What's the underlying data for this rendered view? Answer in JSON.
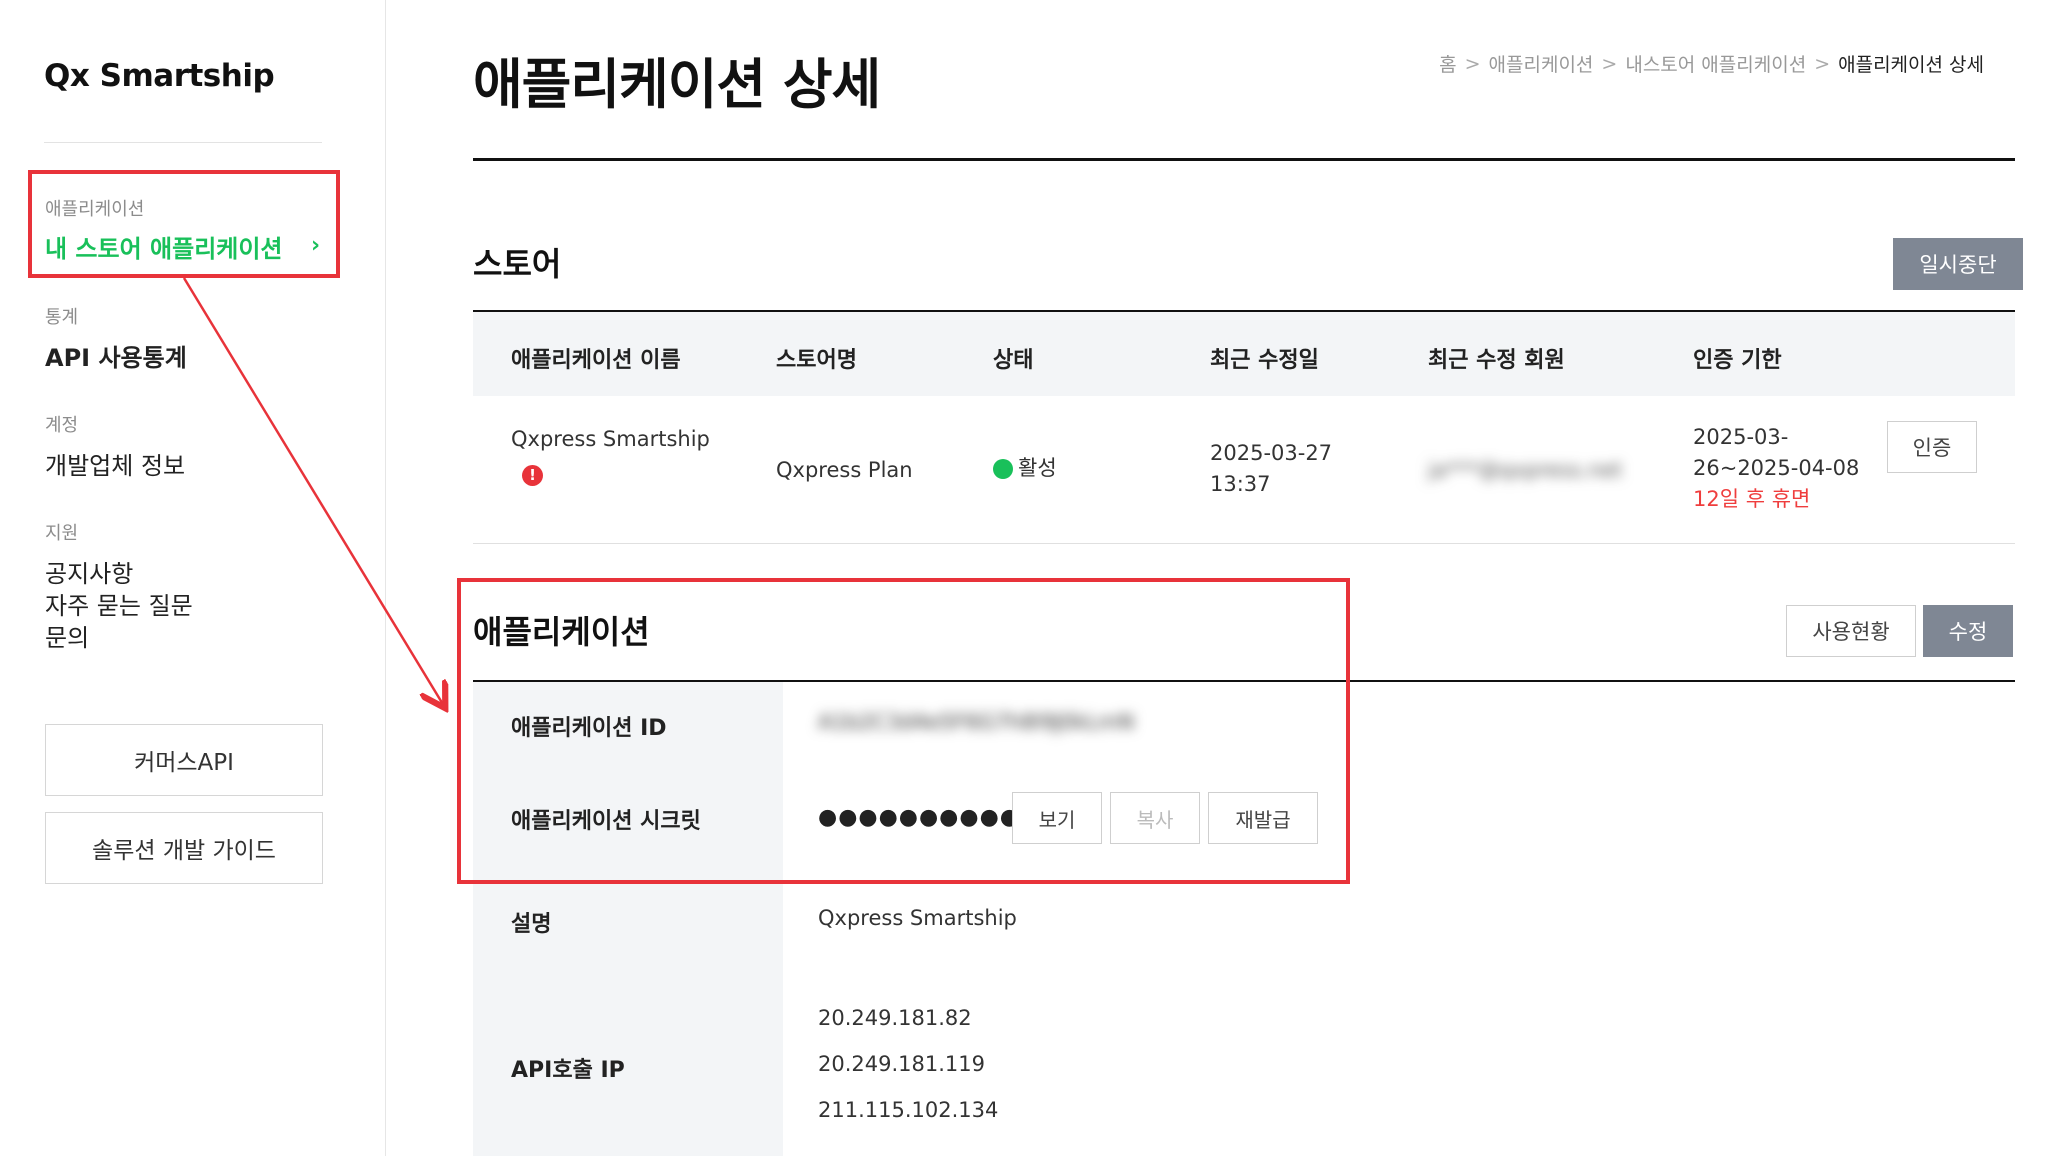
{
  "sidebar": {
    "logo": "Qx Smartship",
    "groups": [
      {
        "title": "애플리케이션",
        "items": [
          "내 스토어 애플리케이션"
        ]
      },
      {
        "title": "통계",
        "items": [
          "API 사용통계"
        ]
      },
      {
        "title": "계정",
        "items": [
          "개발업체 정보"
        ]
      },
      {
        "title": "지원",
        "items": [
          "공지사항",
          "자주 묻는 질문",
          "문의"
        ]
      }
    ],
    "active_chevron": "›",
    "buttons": [
      "커머스API",
      "솔루션 개발 가이드"
    ]
  },
  "header": {
    "title": "애플리케이션 상세",
    "breadcrumb": [
      "홈",
      "애플리케이션",
      "내스토어 애플리케이션",
      "애플리케이션 상세"
    ],
    "breadcrumb_sep": ">"
  },
  "store": {
    "title": "스토어",
    "pause_button": "일시중단",
    "columns": [
      "애플리케이션 이름",
      "스토어명",
      "상태",
      "최근 수정일",
      "최근 수정 회원",
      "인증 기한"
    ],
    "row": {
      "app_name": "Qxpress Smartship",
      "alert_mark": "!",
      "store_name": "Qxpress Plan",
      "status": "활성",
      "modified_date": "2025-03-27",
      "modified_time": "13:37",
      "modified_member": "ja***@qxpress.net",
      "auth_period_line1": "2025-03-",
      "auth_period_line2": "26~2025-04-08",
      "auth_notice": "12일 후 휴면",
      "auth_button": "인증"
    }
  },
  "application": {
    "title": "애플리케이션",
    "usage_button": "사용현황",
    "edit_button": "수정",
    "id_label": "애플리케이션 ID",
    "id_value": "A1b2C3d4e5F6G7h8I9J0kLmN",
    "secret_label": "애플리케이션 시크릿",
    "secret_value": "●●●●●●●●●●●●●",
    "view_button": "보기",
    "copy_button": "복사",
    "reissue_button": "재발급",
    "description_label": "설명",
    "description_value": "Qxpress Smartship",
    "ip_label": "API호출 IP",
    "ips": [
      "20.249.181.82",
      "20.249.181.119",
      "211.115.102.134"
    ]
  },
  "colors": {
    "accent": "#19c05a",
    "highlight": "#e8333a",
    "button_dark": "#7f8794",
    "header_bg": "#f3f5f7"
  }
}
